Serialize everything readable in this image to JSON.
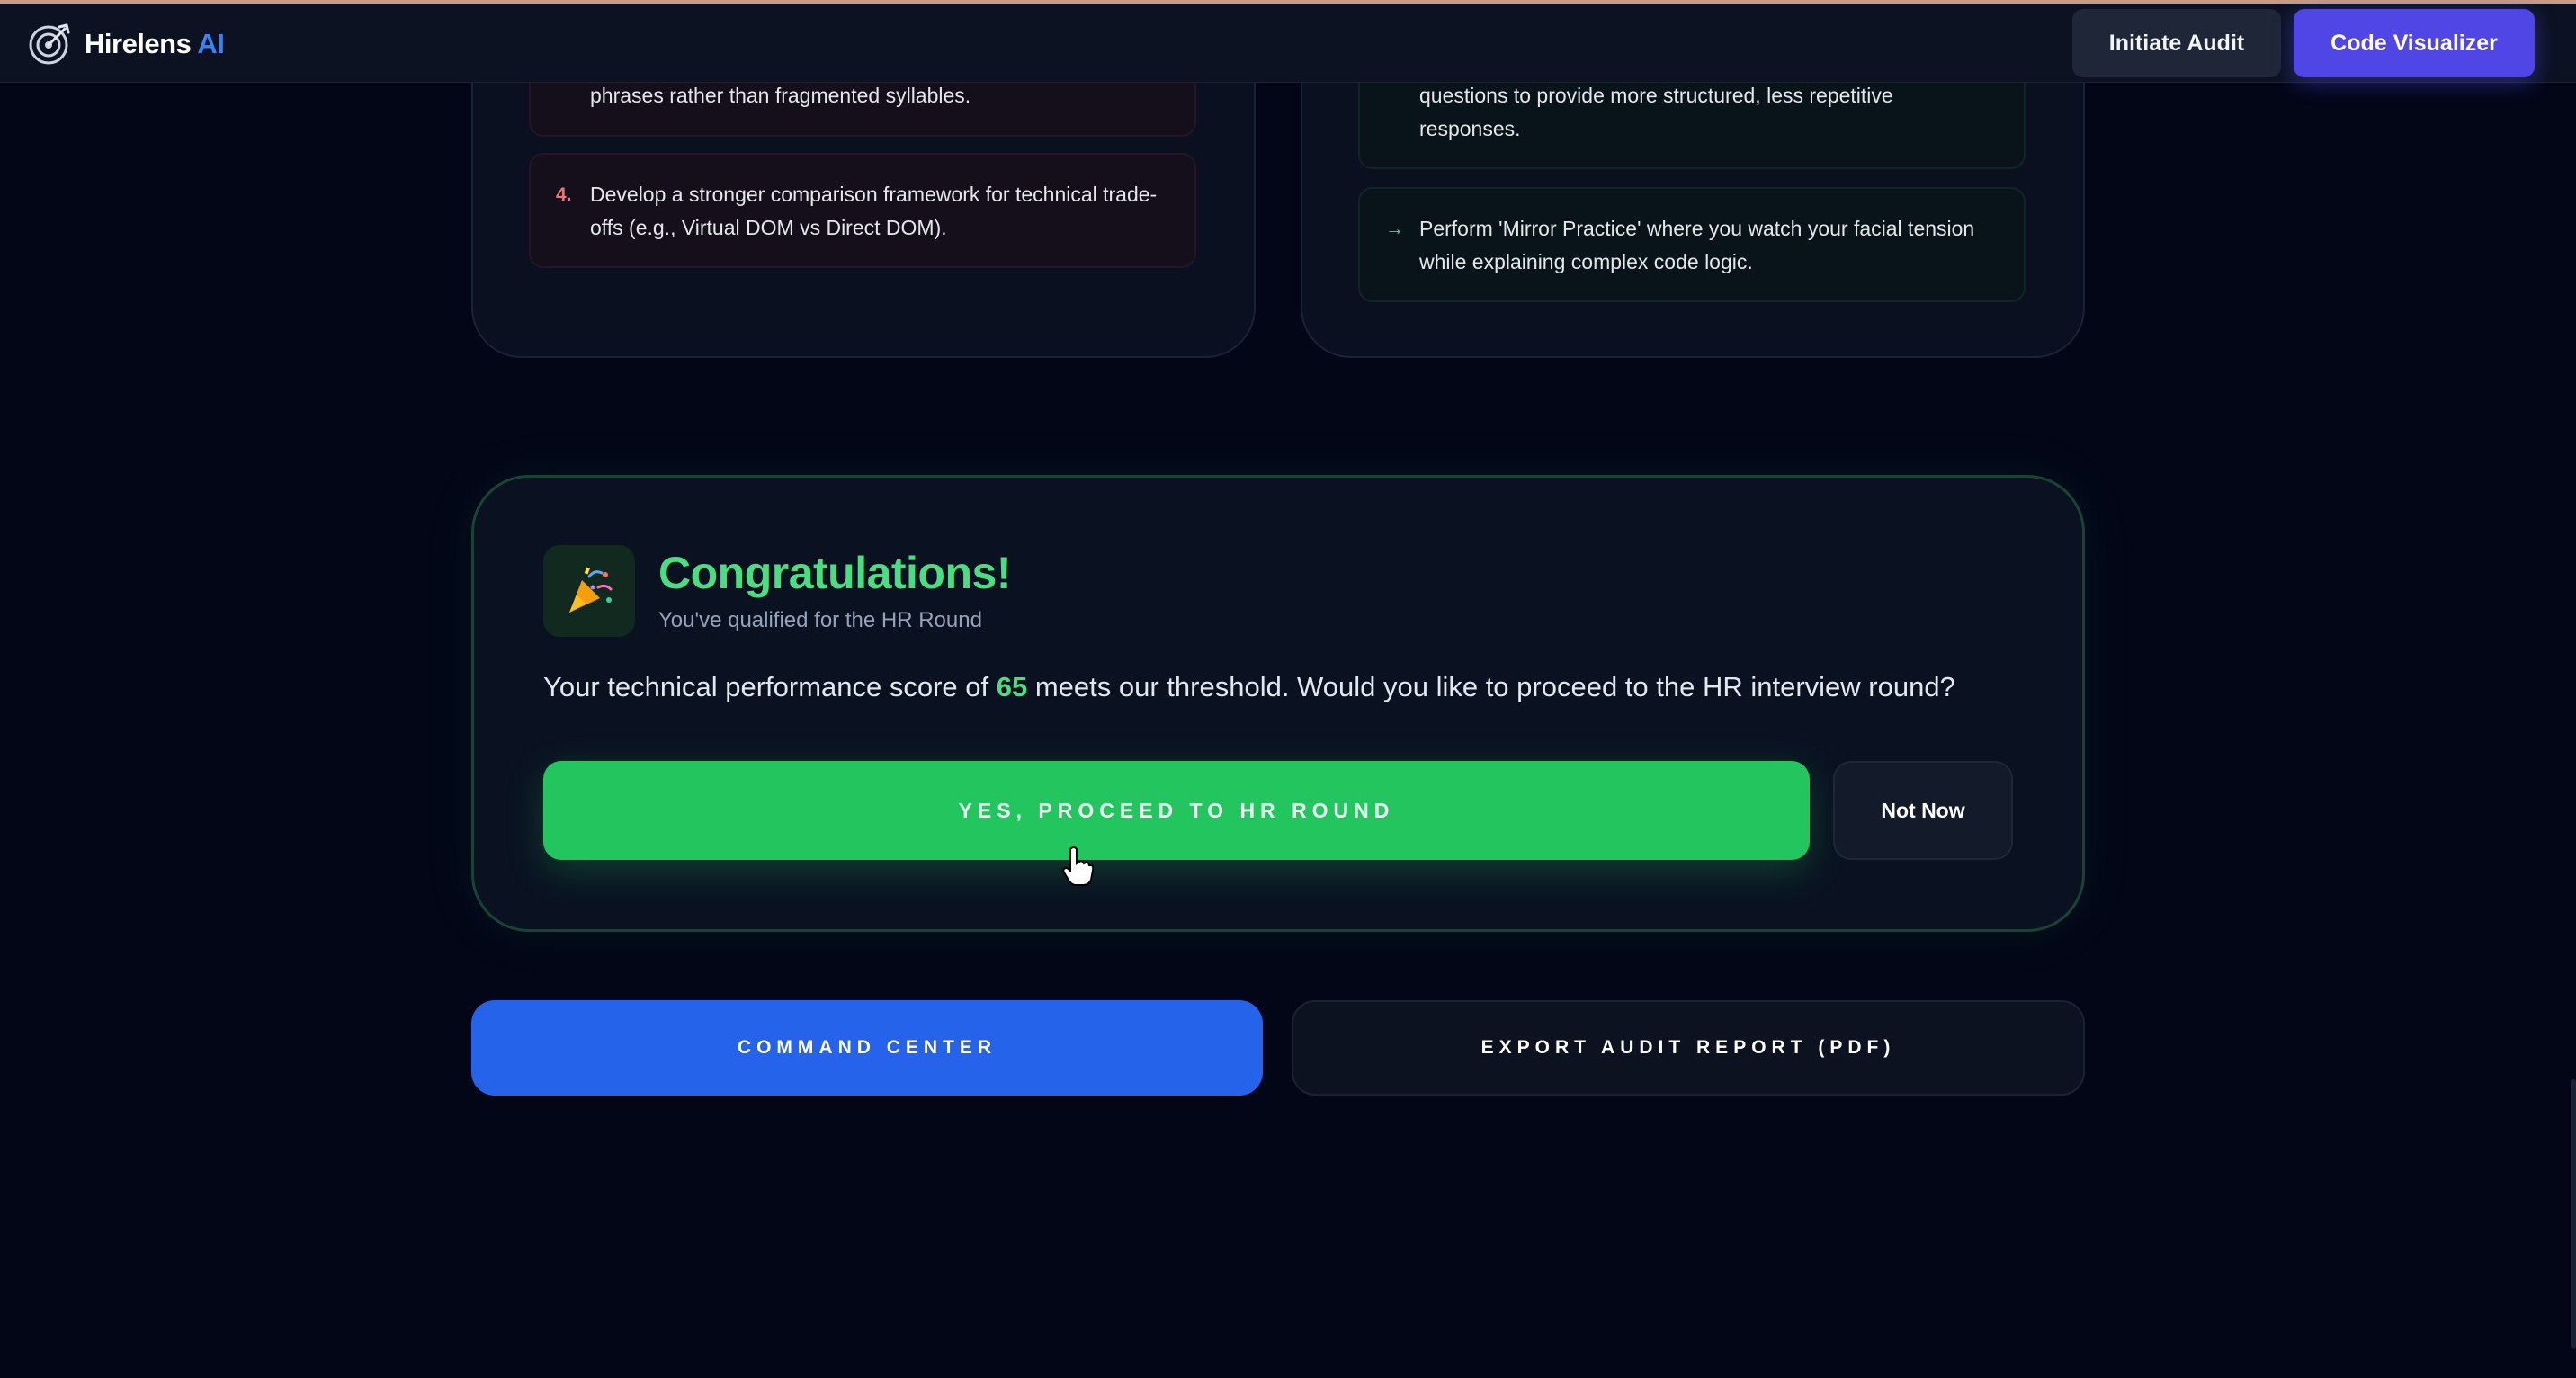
{
  "header": {
    "brand_name": "Hirelens",
    "brand_suffix": "AI",
    "brand_icon": "target-icon",
    "initiate_label": "Initiate Audit",
    "visualizer_label": "Code Visualizer"
  },
  "improvement_card": {
    "items": [
      {
        "marker": "",
        "text": "phrases rather than fragmented syllables."
      },
      {
        "marker": "4.",
        "text": "Develop a stronger comparison framework for technical trade-offs (e.g., Virtual DOM vs Direct DOM)."
      }
    ]
  },
  "practice_card": {
    "items": [
      {
        "marker": "",
        "text": "questions to provide more structured, less repetitive responses."
      },
      {
        "marker": "→",
        "text": "Perform 'Mirror Practice' where you watch your facial tension while explaining complex code logic."
      }
    ]
  },
  "congrats": {
    "icon": "party-popper-icon",
    "title": "Congratulations!",
    "subtitle": "You've qualified for the HR Round",
    "message_before": "Your technical performance score of ",
    "score": "65",
    "message_after": " meets our threshold. Would you like to proceed to the HR interview round?",
    "proceed_label": "YES, PROCEED TO HR ROUND",
    "not_now_label": "Not Now"
  },
  "actions": {
    "command_center_label": "COMMAND CENTER",
    "export_label": "EXPORT AUDIT REPORT (PDF)"
  },
  "colors": {
    "background": "#030617",
    "success": "#22c55e",
    "primary": "#2563eb",
    "accent": "#4f46e5"
  }
}
